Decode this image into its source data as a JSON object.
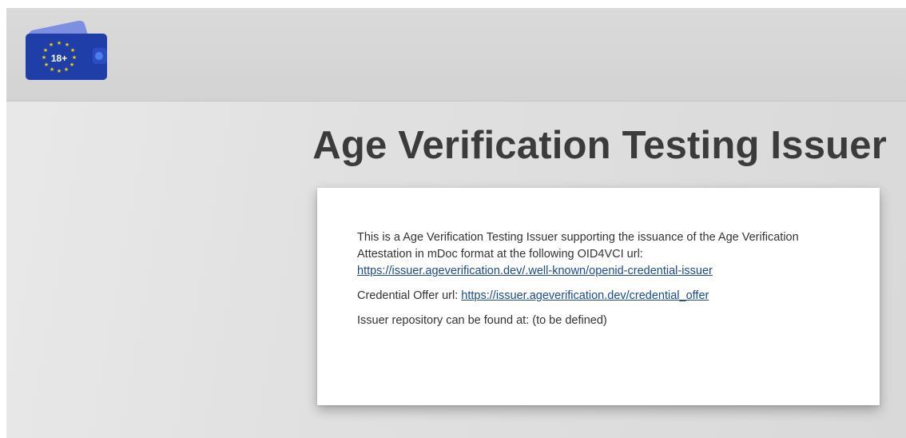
{
  "header": {
    "logo": {
      "icon": "age-18-plus-wallet-icon",
      "text": "18+",
      "colors": {
        "wallet_blue": "#1f3ea8",
        "wallet_back": "#7d8fe0",
        "stars": "#f5d300",
        "clasp": "#4a7fe8"
      }
    }
  },
  "main": {
    "title": "Age Verification Testing Issuer",
    "card": {
      "intro_text": "This is a Age Verification Testing Issuer supporting the issuance of the Age Verification Attestation in mDoc format at the following OID4VCI url:",
      "issuer_url": "https://issuer.ageverification.dev/.well-known/openid-credential-issuer",
      "offer_label": "Credential Offer url:",
      "offer_url": "https://issuer.ageverification.dev/credential_offer",
      "repository_text": "Issuer repository can be found at: (to be defined)"
    }
  }
}
